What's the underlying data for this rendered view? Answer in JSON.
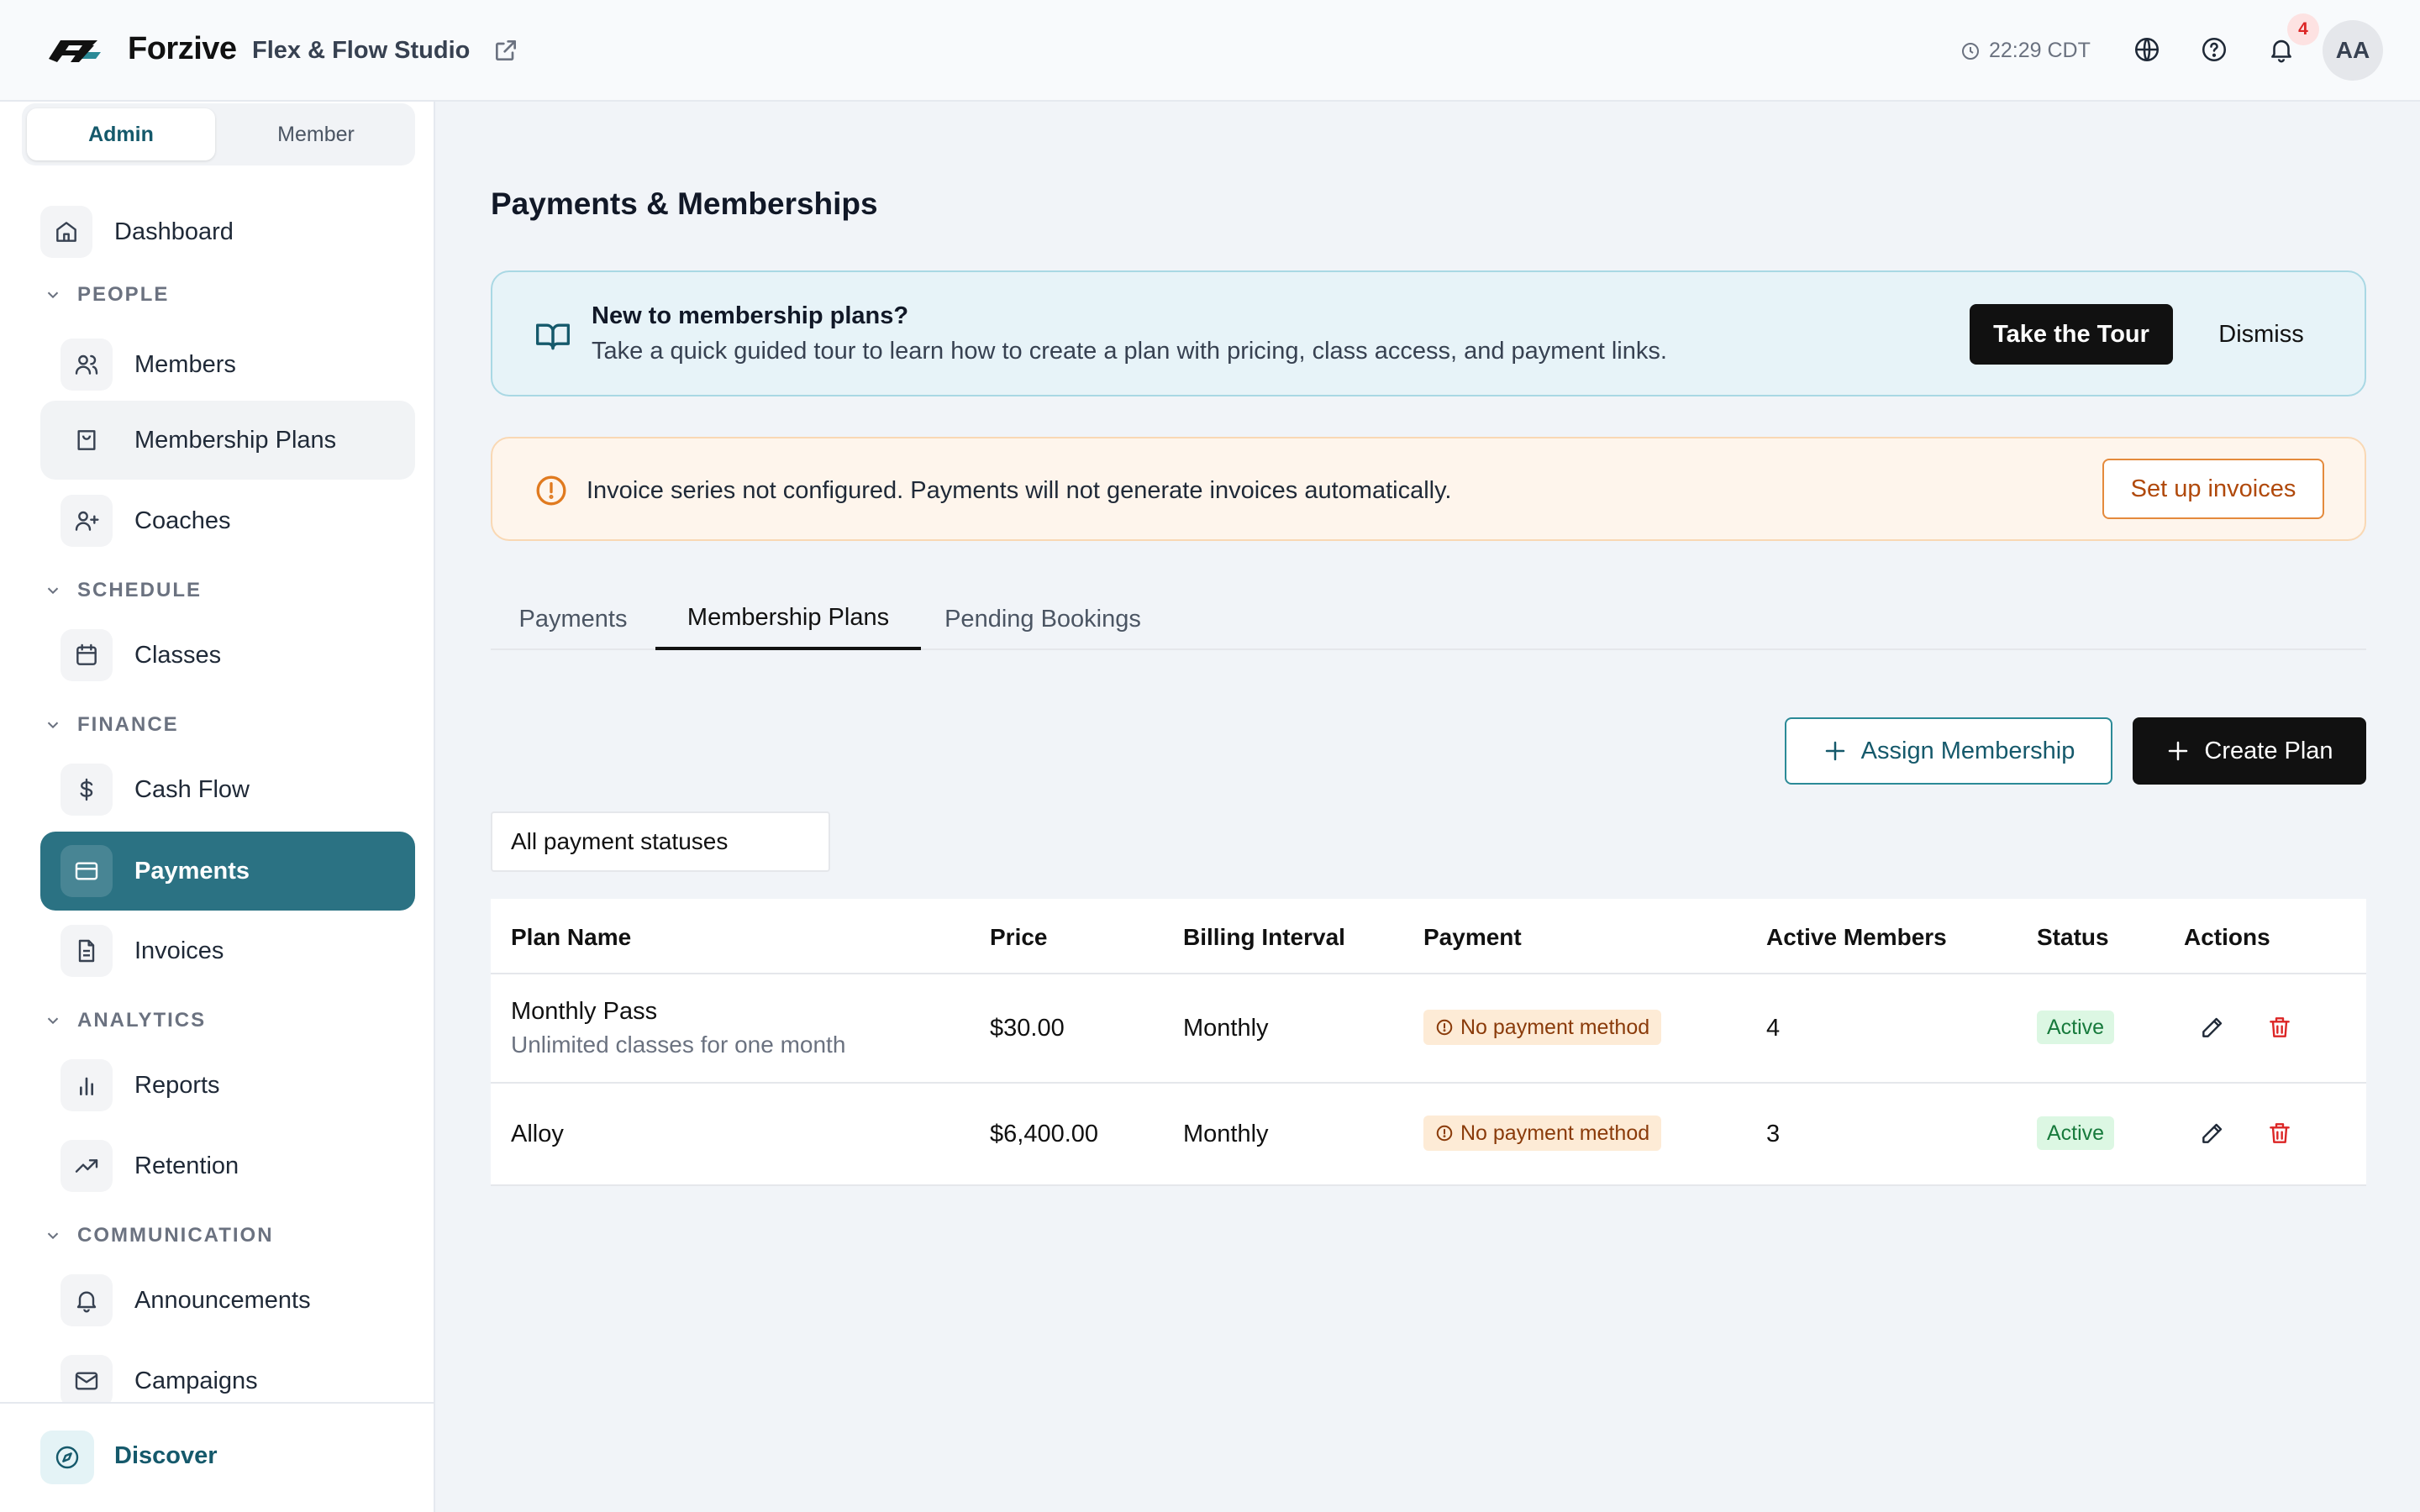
{
  "topbar": {
    "brand": "Forzive",
    "studio": "Flex & Flow Studio",
    "time": "22:29 CDT",
    "notification_count": "4",
    "avatar_initials": "AA"
  },
  "sidebar": {
    "roles": {
      "admin": "Admin",
      "member": "Member"
    },
    "dashboard": "Dashboard",
    "sections": {
      "people": "PEOPLE",
      "schedule": "SCHEDULE",
      "finance": "FINANCE",
      "analytics": "ANALYTICS",
      "communication": "COMMUNICATION"
    },
    "items": {
      "members": "Members",
      "membership_plans": "Membership Plans",
      "coaches": "Coaches",
      "classes": "Classes",
      "cash_flow": "Cash Flow",
      "payments": "Payments",
      "invoices": "Invoices",
      "reports": "Reports",
      "retention": "Retention",
      "announcements": "Announcements",
      "campaigns": "Campaigns"
    },
    "discover": "Discover"
  },
  "main": {
    "title": "Payments & Memberships",
    "tour_banner": {
      "title": "New to membership plans?",
      "description": "Take a quick guided tour to learn how to create a plan with pricing, class access, and payment links.",
      "tour_button": "Take the Tour",
      "dismiss_button": "Dismiss"
    },
    "invoice_banner": {
      "text": "Invoice series not configured. Payments will not generate invoices automatically.",
      "button": "Set up invoices"
    },
    "tabs": [
      "Payments",
      "Membership Plans",
      "Pending Bookings"
    ],
    "assign_button": "Assign Membership",
    "create_button": "Create Plan",
    "status_filter": "All payment statuses",
    "table": {
      "headers": [
        "Plan Name",
        "Price",
        "Billing Interval",
        "Payment",
        "Active Members",
        "Status",
        "Actions"
      ],
      "rows": [
        {
          "name": "Monthly Pass",
          "description": "Unlimited classes for one month",
          "price": "$30.00",
          "interval": "Monthly",
          "payment": "No payment method",
          "active_members": "4",
          "status": "Active"
        },
        {
          "name": "Alloy",
          "description": "",
          "price": "$6,400.00",
          "interval": "Monthly",
          "payment": "No payment method",
          "active_members": "3",
          "status": "Active"
        }
      ]
    }
  },
  "colors": {
    "primary_teal": "#2b7283",
    "tour_banner_bg": "#e7f3f8",
    "warning_bg": "#fef5ec",
    "warning_accent": "#e48a3c",
    "active_green": "#177a3c",
    "delete_red": "#dc2626"
  }
}
